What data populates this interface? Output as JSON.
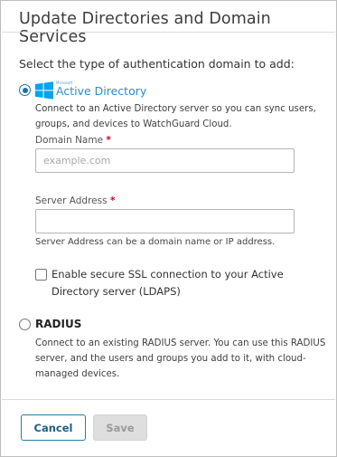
{
  "dialog": {
    "title": "Update Directories and Domain Services",
    "prompt": "Select the type of authentication domain to add:"
  },
  "options": {
    "active_directory": {
      "selected": true,
      "logo_caption": "Microsoft",
      "label": "Active Directory",
      "description_line1": "Connect to an Active Directory server so you can sync users,",
      "description_line2": "groups, and devices to WatchGuard Cloud.",
      "domain_name": {
        "label": "Domain Name",
        "required_marker": "*",
        "value": "",
        "placeholder": "example.com"
      },
      "server_address": {
        "label": "Server Address",
        "required_marker": "*",
        "value": "",
        "placeholder": "",
        "hint": "Server Address can be a domain name or IP address."
      },
      "ssl_checkbox": {
        "checked": false,
        "label_line1": "Enable secure SSL connection to your Active",
        "label_line2": "Directory server (LDAPS)"
      }
    },
    "radius": {
      "selected": false,
      "label": "RADIUS",
      "description_line1": "Connect to an existing RADIUS server. You can use this RADIUS",
      "description_line2": "server, and the users and groups you add to it, with cloud-",
      "description_line3": "managed devices."
    }
  },
  "buttons": {
    "cancel_label": "Cancel",
    "save_label": "Save",
    "save_enabled": false
  },
  "colors": {
    "accent": "#1f6fae",
    "required": "#d0021b",
    "ms_red": "#f25022",
    "ms_green": "#7fba00",
    "ms_blue": "#00a4ef",
    "ms_yellow": "#ffb900"
  }
}
